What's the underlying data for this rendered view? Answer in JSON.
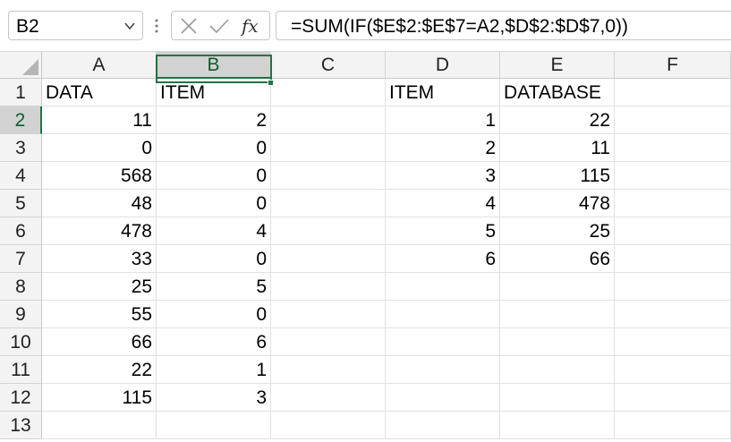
{
  "formula_bar": {
    "name_box": "B2",
    "fx_label": "fx",
    "formula": "=SUM(IF($E$2:$E$7=A2,$D$2:$D$7,0))"
  },
  "sheet": {
    "columns": [
      "A",
      "B",
      "C",
      "D",
      "E",
      "F"
    ],
    "rows": [
      "1",
      "2",
      "3",
      "4",
      "5",
      "6",
      "7",
      "8",
      "9",
      "10",
      "11",
      "12",
      "13"
    ],
    "selected_cell": "B2",
    "colA": [
      "DATA",
      "11",
      "0",
      "568",
      "48",
      "478",
      "33",
      "25",
      "55",
      "66",
      "22",
      "115",
      ""
    ],
    "colB": [
      "ITEM",
      "2",
      "0",
      "0",
      "0",
      "4",
      "0",
      "5",
      "0",
      "6",
      "1",
      "3",
      ""
    ],
    "colC": [
      "",
      "",
      "",
      "",
      "",
      "",
      "",
      "",
      "",
      "",
      "",
      "",
      ""
    ],
    "colD": [
      "ITEM",
      "1",
      "2",
      "3",
      "4",
      "5",
      "6",
      "",
      "",
      "",
      "",
      "",
      ""
    ],
    "colE": [
      "DATABASE",
      "22",
      "11",
      "115",
      "478",
      "25",
      "66",
      "",
      "",
      "",
      "",
      "",
      ""
    ],
    "colF": [
      "",
      "",
      "",
      "",
      "",
      "",
      "",
      "",
      "",
      "",
      "",
      "",
      ""
    ]
  },
  "colors": {
    "accent": "#217346",
    "header_bg": "#f3f3f3",
    "selected_header_bg": "#d2d2d2",
    "gridline": "#e1e1e1"
  }
}
